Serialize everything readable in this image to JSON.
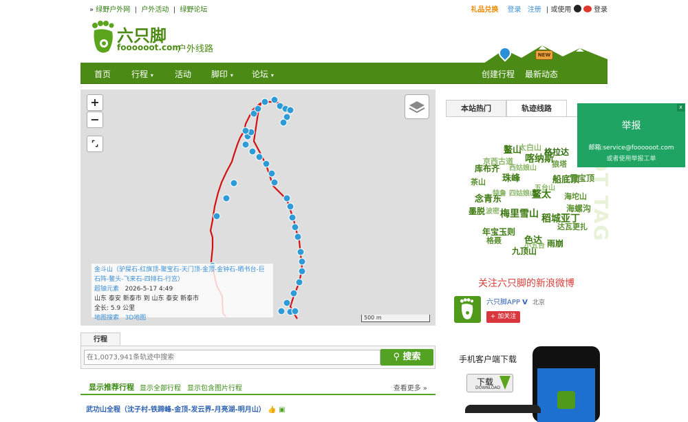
{
  "topbar": {
    "links": [
      "绿野户外网",
      "户外活动",
      "绿野论坛"
    ],
    "gift": "礼品兑换",
    "login": "登录",
    "register": "注册",
    "or_use": "或使用",
    "login2": "登录"
  },
  "logo": {
    "name": "六只脚",
    "domain": "foooooot.com",
    "subtitle": "户外线路"
  },
  "nav": {
    "items": [
      "首页",
      "行程",
      "活动",
      "脚印",
      "论坛"
    ],
    "create": "创建行程",
    "news": "最新动态",
    "new_badge": "NEW"
  },
  "map": {
    "zoom_in": "+",
    "zoom_out": "−",
    "scale": "500 m",
    "info": {
      "title": "金斗山（驴屎石-红旗顶-聚宝石-天门顶-金顶-金钟石-晒书台-巨石阵-鳌头-飞来石-四排石-行宫）",
      "user": "超铀元素",
      "date": "2026-5-17 4:49",
      "route": "山东 泰安 新泰市 到 山东 泰安 新泰市",
      "length": "全长: 5.9 公里",
      "link1": "地图搜索",
      "link2": "3D地图"
    }
  },
  "search": {
    "tab": "行程",
    "placeholder": "在1,0073,941条轨迹中搜索",
    "button": "搜索"
  },
  "list": {
    "tab1": "显示推荐行程",
    "tab2": "显示全部行程",
    "tab3": "显示包含图片行程",
    "more": "查看更多 »",
    "first_item": "武功山全程（沈子村-铁蹄峰-金顶-发云界-月亮湖-明月山）"
  },
  "side": {
    "tab_hot": "本站热门",
    "tab_tracks": "轨迹线路",
    "tags": [
      "鳌山",
      "太白山",
      "格拉达",
      "京西古道",
      "喀纳斯",
      "库布齐",
      "西姑娘山",
      "狼塔",
      "珠峰",
      "茶山",
      "船底顶",
      "雪宝顶",
      "五台山",
      "四姑娘山",
      "念青东",
      "特鲁",
      "鳌太",
      "海坨山",
      "墨脱",
      "波密",
      "梅里雪山",
      "稻城亚丁",
      "海螺沟",
      "达瓦更扎",
      "年宝玉则",
      "格聂",
      "色达",
      "九顶山",
      "雨崩",
      "小五台"
    ],
    "watermark": "HOT TAG",
    "weibo_title": "关注六只脚的新浪微博",
    "app_name": "六只脚APP",
    "app_loc": "北京",
    "follow": "+ 加关注",
    "download_title": "手机客户端下载",
    "download_btn": "下载",
    "download_sub": "DOWNLOAD"
  },
  "popup": {
    "title": "举报",
    "email": "邮箱:service@foooooot.com",
    "link": "或者使用举报工单",
    "close": "x"
  }
}
